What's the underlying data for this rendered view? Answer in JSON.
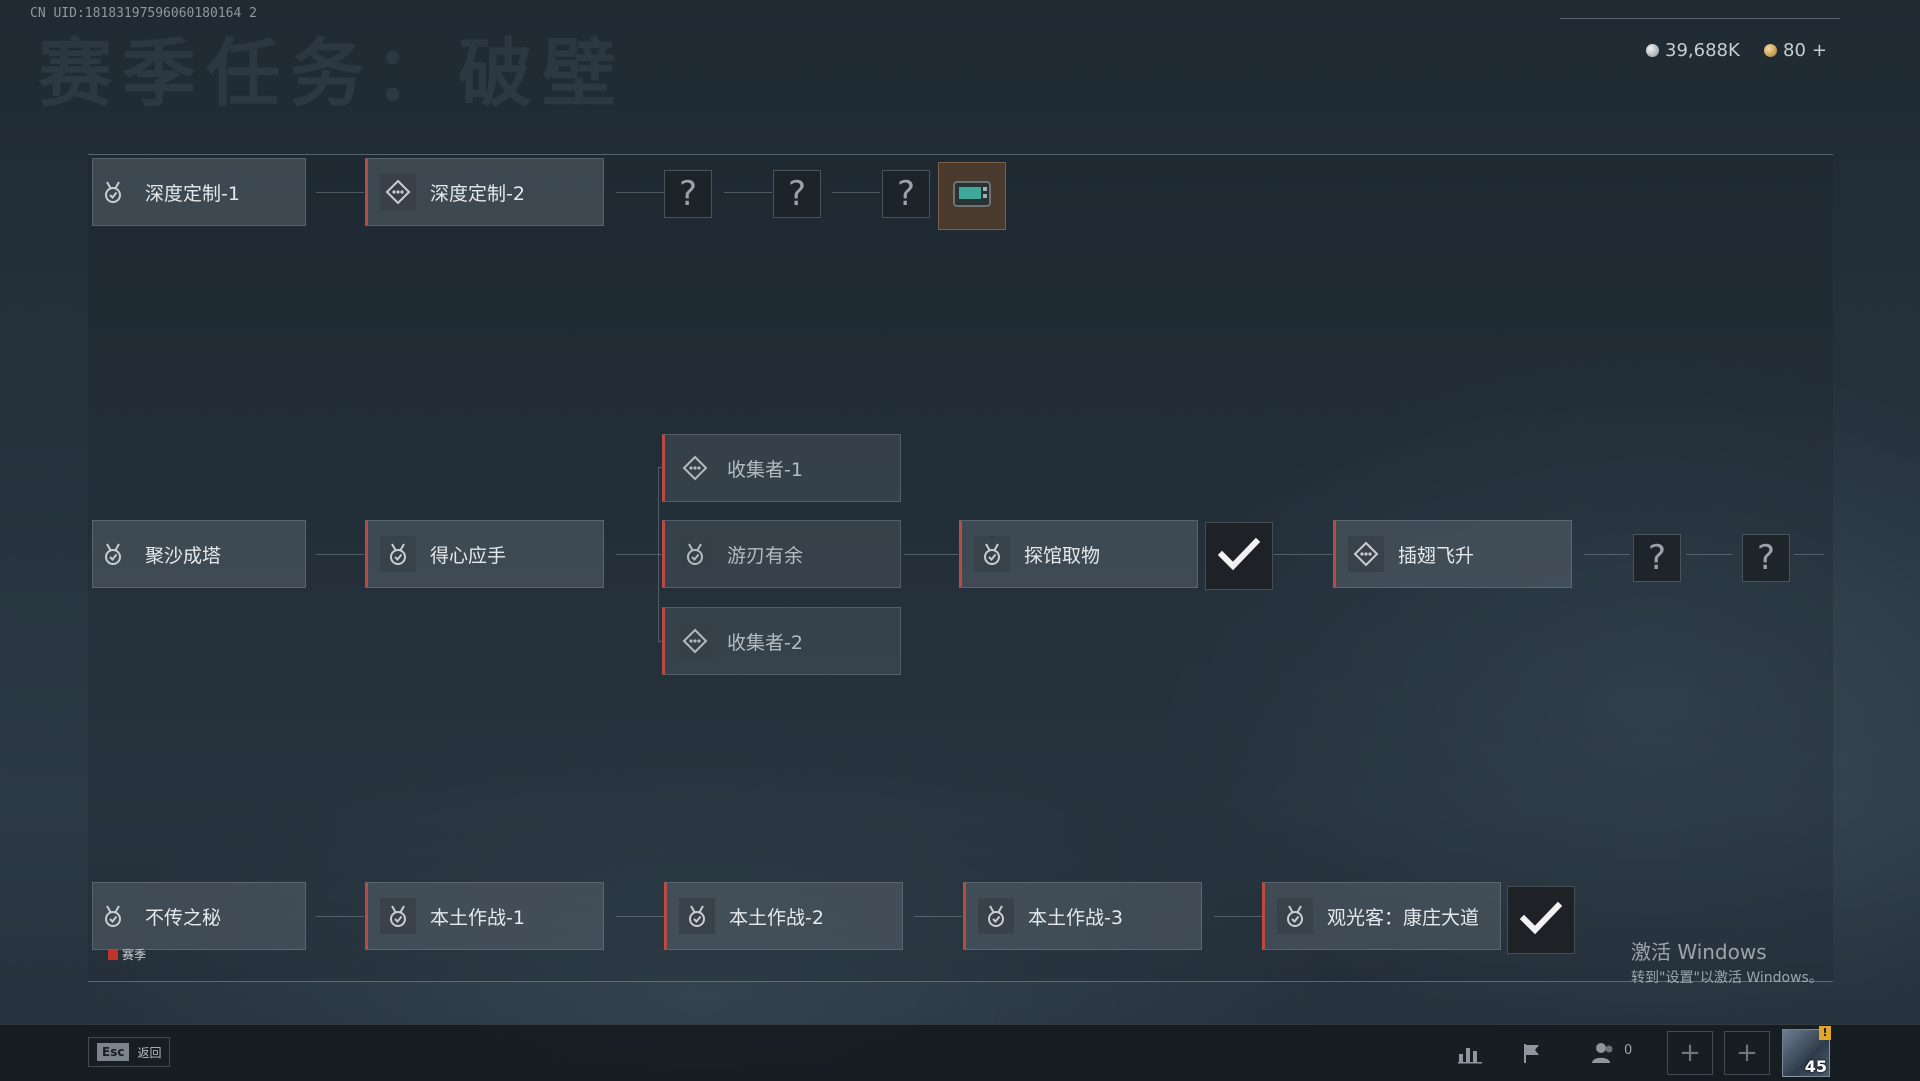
{
  "header": {
    "uid_text": "CN UID:18183197596060180164 2",
    "page_title": "赛季任务：破壁",
    "currency_silver": "39,688K",
    "currency_gold": "80",
    "currency_gold_add": "+"
  },
  "row_top": {
    "cards": [
      {
        "label": "深度定制-1",
        "icon": "medal-check-icon"
      },
      {
        "label": "深度定制-2",
        "icon": "diamond-dots-icon"
      }
    ],
    "unknown_label": "?",
    "reward_icon": "device-chip-icon"
  },
  "row_middle": {
    "cards": [
      {
        "label": "聚沙成塔",
        "icon": "medal-check-icon"
      },
      {
        "label": "得心应手",
        "icon": "medal-check-icon"
      },
      {
        "label": "收集者-1",
        "icon": "diamond-dots-icon"
      },
      {
        "label": "游刃有余",
        "icon": "medal-check-icon"
      },
      {
        "label": "收集者-2",
        "icon": "diamond-dots-icon"
      },
      {
        "label": "探馆取物",
        "icon": "medal-check-icon"
      },
      {
        "label": "插翅飞升",
        "icon": "diamond-dots-icon"
      }
    ],
    "unknown_label": "?"
  },
  "row_bottom": {
    "cards": [
      {
        "label": "不传之秘",
        "icon": "medal-check-icon"
      },
      {
        "label": "本土作战-1",
        "icon": "medal-check-icon"
      },
      {
        "label": "本土作战-2",
        "icon": "medal-check-icon"
      },
      {
        "label": "本土作战-3",
        "icon": "medal-check-icon"
      },
      {
        "label": "观光客：康庄大道",
        "icon": "medal-check-icon"
      }
    ],
    "season_tag": "赛季"
  },
  "watermark": {
    "line1": "激活 Windows",
    "line2": "转到\"设置\"以激活 Windows。"
  },
  "bottom_bar": {
    "esc_key": "Esc",
    "esc_label": "返回",
    "friends_count": "0",
    "player_level": "45",
    "alert_badge": "!",
    "slot_plus": "+"
  },
  "colors": {
    "accent_red": "#b94a44",
    "card_bg": "#55606a",
    "check_bg": "#1e2227"
  }
}
